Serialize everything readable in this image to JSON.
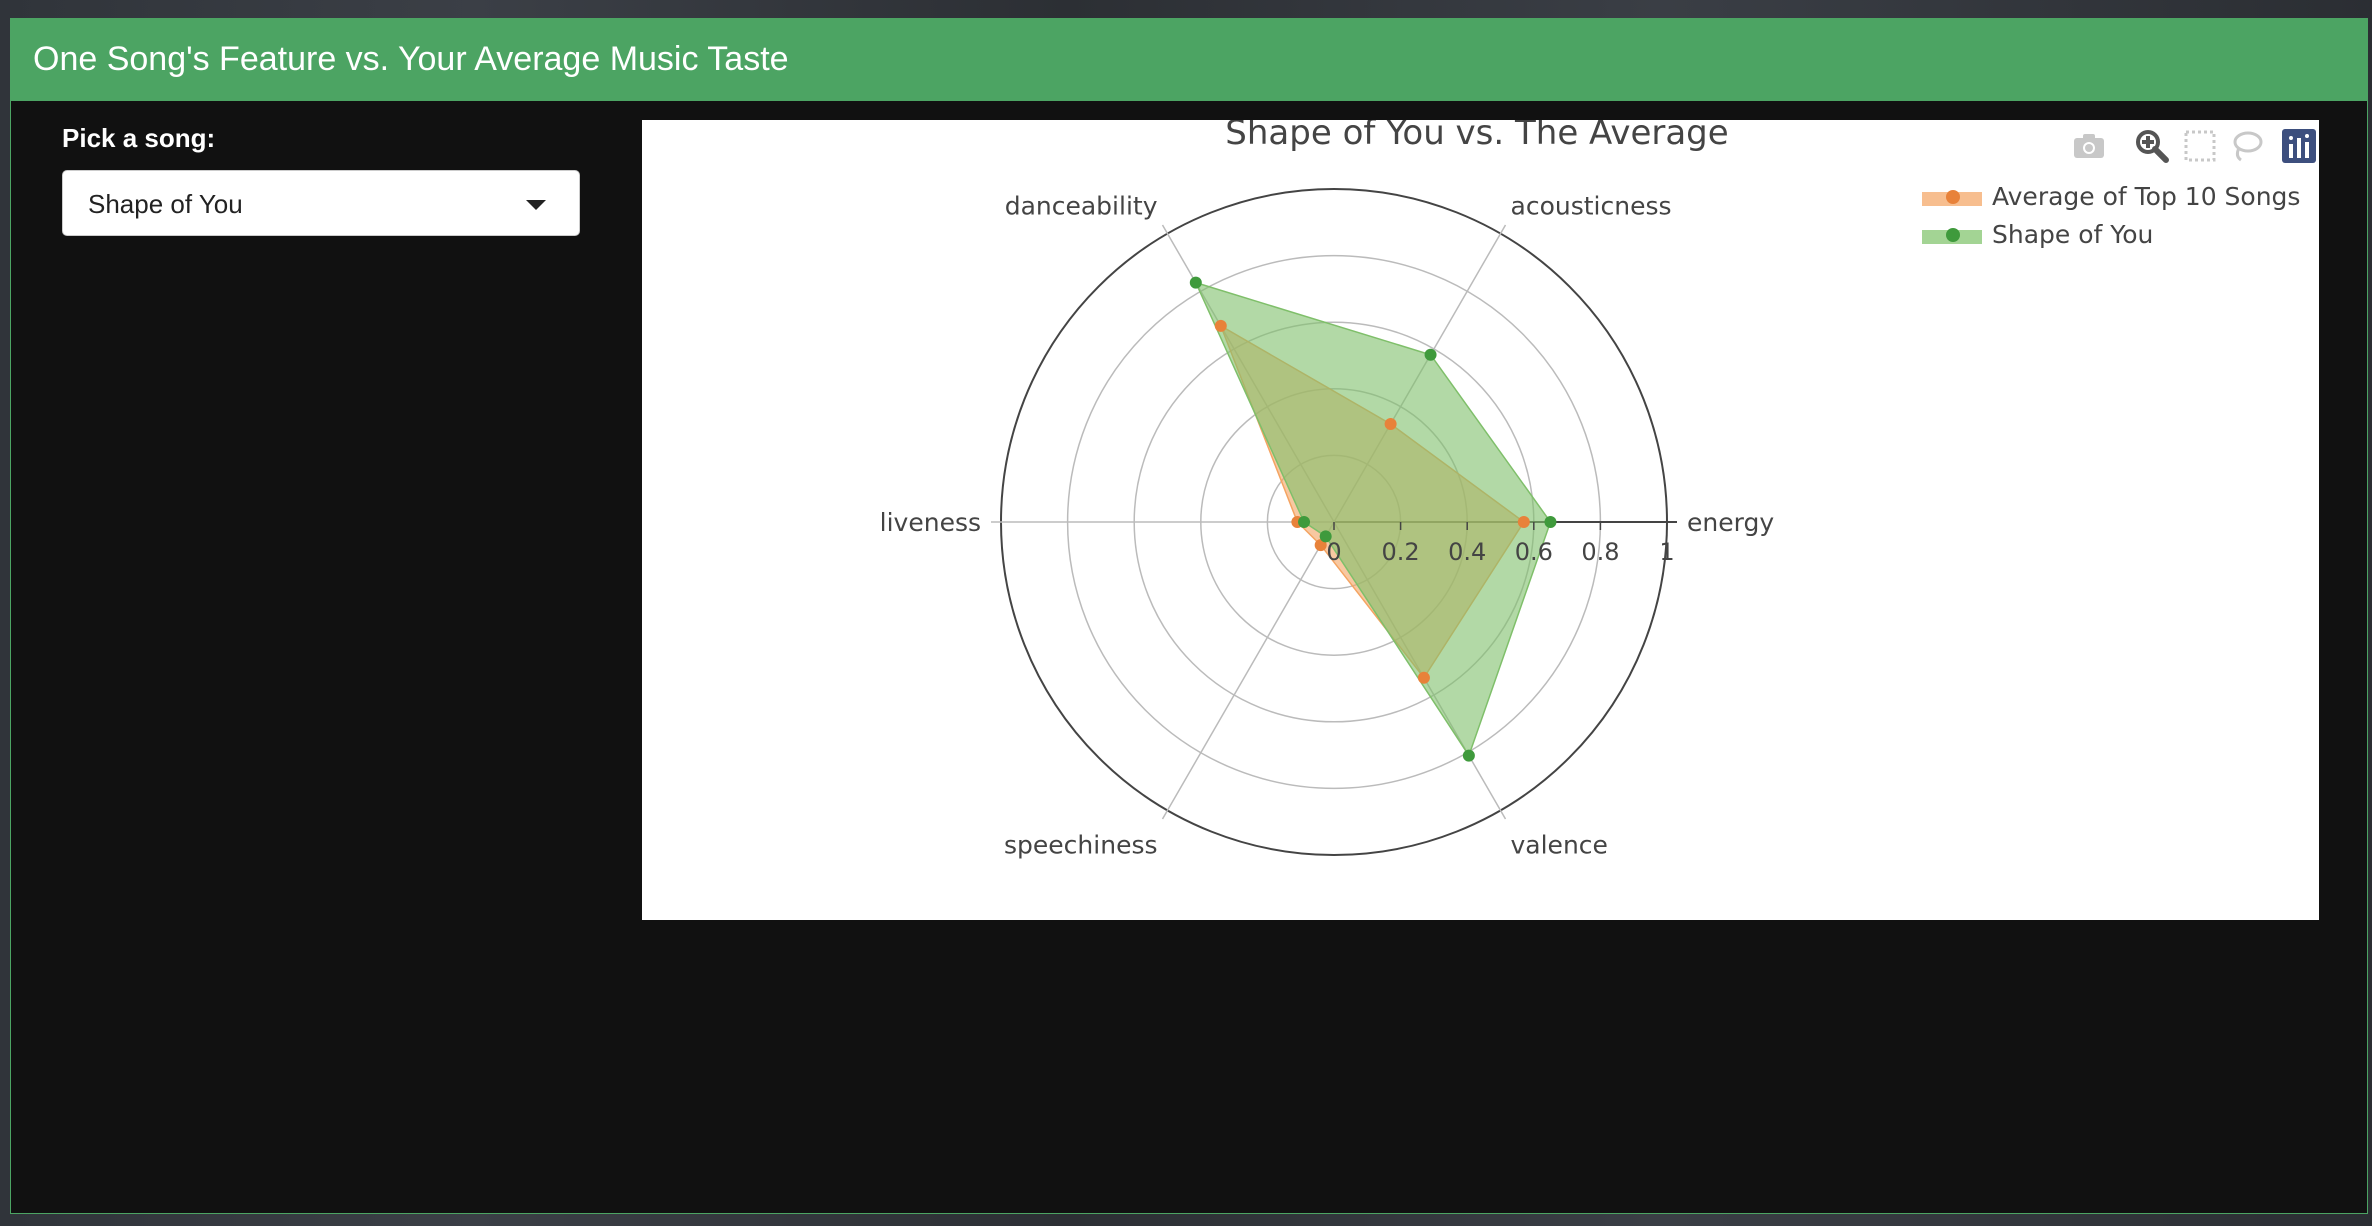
{
  "app": {
    "title": "One Song's Feature vs. Your Average Music Taste"
  },
  "control": {
    "label": "Pick a song:",
    "selected": "Shape of You"
  },
  "modebar": {
    "buttons": [
      "camera-icon",
      "zoom-icon",
      "box-select-icon",
      "lasso-icon",
      "plotly-logo-icon"
    ]
  },
  "chart_data": {
    "type": "radar",
    "title": "Shape of You vs. The Average",
    "axes": [
      "energy",
      "acousticness",
      "danceability",
      "liveness",
      "speechiness",
      "valence"
    ],
    "radial_range": [
      0,
      1
    ],
    "radial_ticks": [
      "0",
      "0.2",
      "0.4",
      "0.6",
      "0.8",
      "1"
    ],
    "grid": true,
    "legend_position": "top-right",
    "series": [
      {
        "name": "Average of Top 10 Songs",
        "color": "#f4a462",
        "marker_color": "#e8823a",
        "values": [
          0.57,
          0.34,
          0.68,
          0.11,
          0.08,
          0.54
        ]
      },
      {
        "name": "Shape of You",
        "color": "#7fbf6a",
        "marker_color": "#3f9a3c",
        "values": [
          0.65,
          0.58,
          0.83,
          0.09,
          0.05,
          0.81
        ]
      }
    ]
  }
}
